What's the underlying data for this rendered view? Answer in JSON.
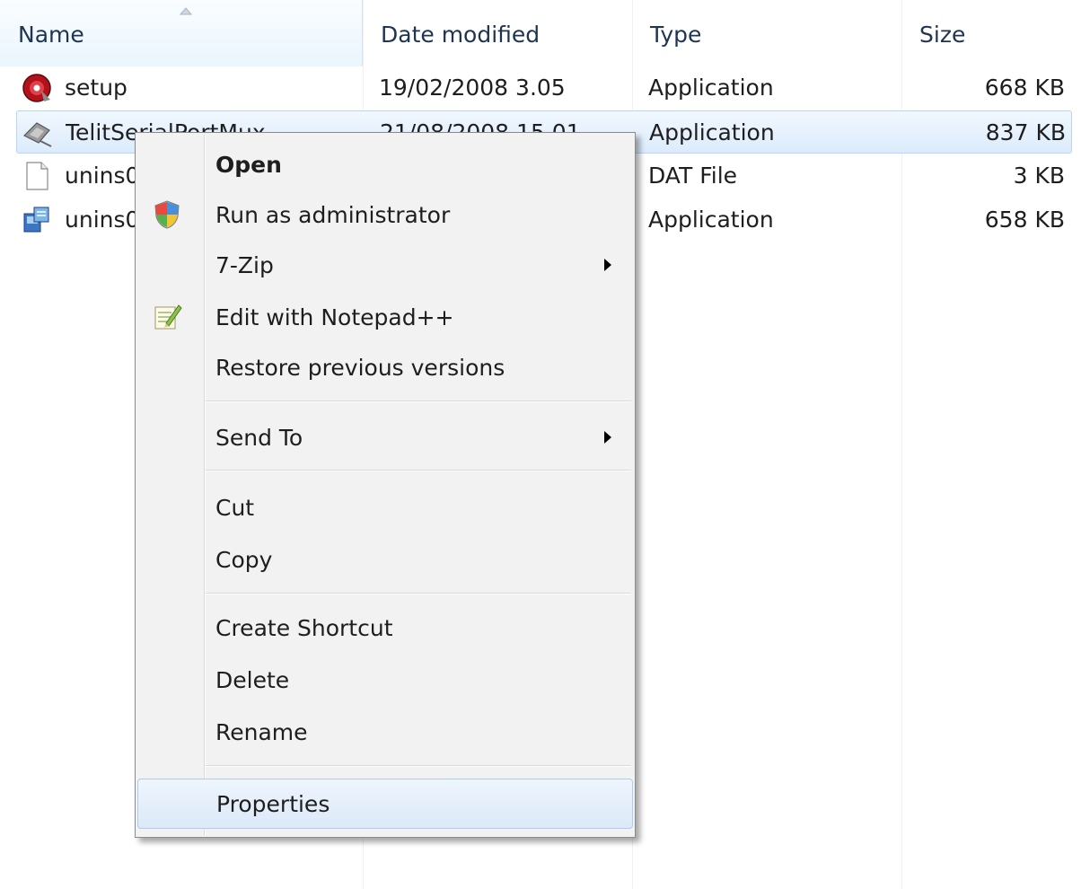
{
  "columns": [
    {
      "label": "Name"
    },
    {
      "label": "Date modified"
    },
    {
      "label": "Type"
    },
    {
      "label": "Size"
    }
  ],
  "files": [
    {
      "name": "setup",
      "date": "19/02/2008 3.05",
      "type": "Application",
      "size": "668 KB",
      "icon": "setup-disc-icon"
    },
    {
      "name": "TelitSerialPortMux",
      "date": "21/08/2008 15.01",
      "type": "Application",
      "size": "837 KB",
      "icon": "serial-port-app-icon",
      "selected": true
    },
    {
      "name": "unins0",
      "date": "",
      "type": "DAT File",
      "size": "3 KB",
      "icon": "document-file-icon"
    },
    {
      "name": "unins0",
      "date": "",
      "type": "Application",
      "size": "658 KB",
      "icon": "uninstaller-icon"
    }
  ],
  "context_menu": {
    "items": [
      {
        "label": "Open",
        "bold": true
      },
      {
        "label": "Run as administrator",
        "icon": "uac-shield-icon"
      },
      {
        "label": "7-Zip",
        "submenu": true
      },
      {
        "label": "Edit with Notepad++",
        "icon": "notepad-plus-plus-icon"
      },
      {
        "label": "Restore previous versions"
      },
      {
        "label": "Send To",
        "submenu": true
      },
      {
        "label": "Cut"
      },
      {
        "label": "Copy"
      },
      {
        "label": "Create Shortcut"
      },
      {
        "label": "Delete"
      },
      {
        "label": "Rename"
      },
      {
        "label": "Properties",
        "highlighted": true
      }
    ]
  },
  "colors": {
    "selection_border": "#b8d6fb",
    "selection_fill": "#dcebfc",
    "menu_background": "#f2f2f2",
    "menu_border": "#8b8b8b"
  }
}
